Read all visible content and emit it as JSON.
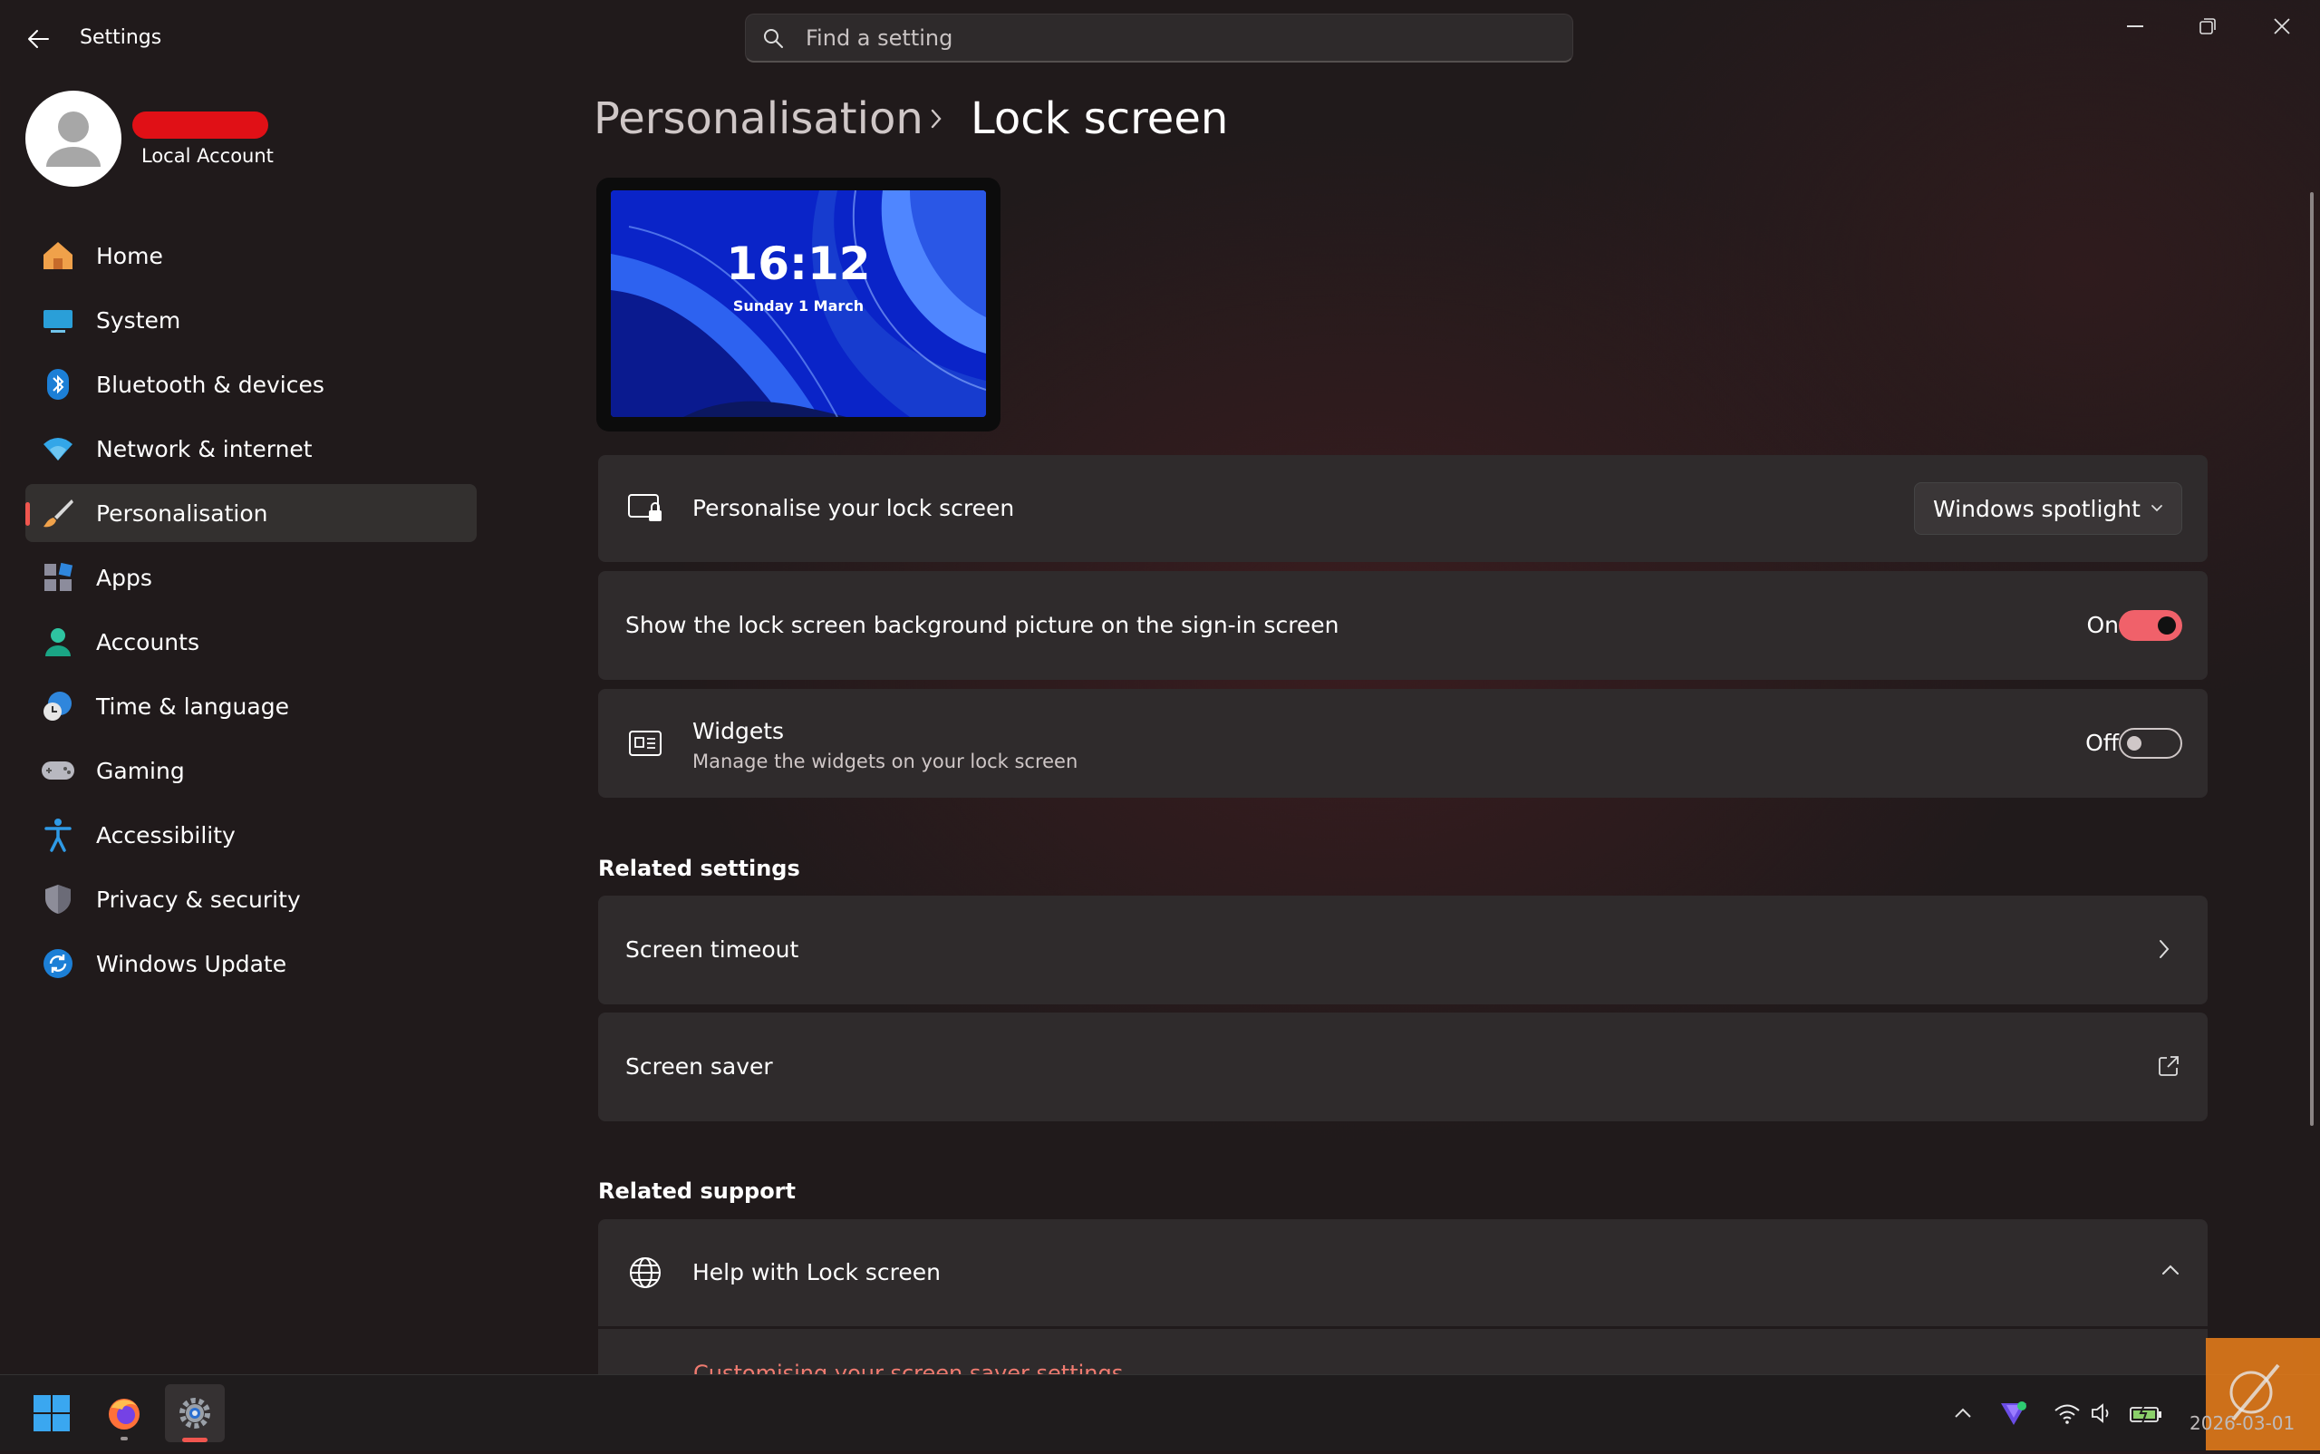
{
  "app": {
    "title": "Settings"
  },
  "search": {
    "placeholder": "Find a setting"
  },
  "profile": {
    "account_type": "Local Account"
  },
  "sidebar": {
    "items": [
      {
        "label": "Home",
        "icon": "home-icon"
      },
      {
        "label": "System",
        "icon": "system-icon"
      },
      {
        "label": "Bluetooth & devices",
        "icon": "bluetooth-icon"
      },
      {
        "label": "Network & internet",
        "icon": "wifi-icon"
      },
      {
        "label": "Personalisation",
        "icon": "brush-icon",
        "selected": true
      },
      {
        "label": "Apps",
        "icon": "apps-icon"
      },
      {
        "label": "Accounts",
        "icon": "accounts-icon"
      },
      {
        "label": "Time & language",
        "icon": "time-language-icon"
      },
      {
        "label": "Gaming",
        "icon": "gamepad-icon"
      },
      {
        "label": "Accessibility",
        "icon": "accessibility-icon"
      },
      {
        "label": "Privacy & security",
        "icon": "shield-icon"
      },
      {
        "label": "Windows Update",
        "icon": "update-icon"
      }
    ]
  },
  "breadcrumb": {
    "parent": "Personalisation",
    "current": "Lock screen"
  },
  "preview": {
    "time": "16:12",
    "date": "Sunday 1 March"
  },
  "settings": {
    "personalise": {
      "label": "Personalise your lock screen",
      "value": "Windows spotlight"
    },
    "background_on_signin": {
      "label": "Show the lock screen background picture on the sign-in screen",
      "state": "On"
    },
    "widgets": {
      "label": "Widgets",
      "description": "Manage the widgets on your lock screen",
      "state": "Off"
    }
  },
  "related_settings": {
    "heading": "Related settings",
    "items": [
      {
        "label": "Screen timeout"
      },
      {
        "label": "Screen saver"
      }
    ]
  },
  "related_support": {
    "heading": "Related support",
    "help_title": "Help with Lock screen",
    "link": "Customising your screen saver settings"
  },
  "taskbar": {
    "clock": "2026-03-01"
  },
  "colors": {
    "accent": "#f0564f",
    "toggle_on": "#f0616a",
    "link": "#f07b70",
    "card": "#2f2b2c"
  }
}
